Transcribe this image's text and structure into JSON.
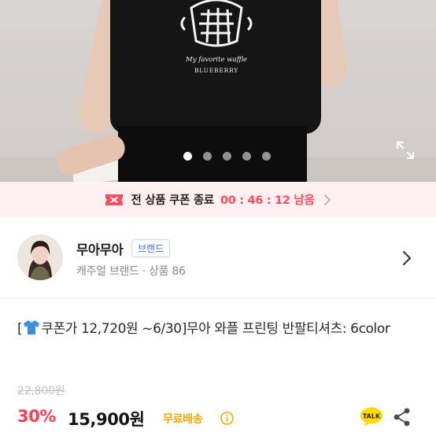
{
  "hero": {
    "print_line1": "My favorite waffle",
    "print_line2": "BLUEBERRY",
    "page_dots": 5,
    "active_dot": 1,
    "expand_icon": "expand-icon"
  },
  "coupon_strip": {
    "icon": "coupon-ticket-icon",
    "label": "전 상품 쿠폰 종료",
    "timer": "00 : 46 : 12 남음",
    "accent_color": "#ff4b5e",
    "background": "#fff0f2"
  },
  "shop": {
    "name": "무아무아",
    "badge": "브랜드",
    "meta": "캐주얼 브랜드 · 상품 86"
  },
  "product": {
    "title_prefix": "[",
    "title_icon": "t-shirt-emoji-icon",
    "title_rest": "쿠폰가 12,720원 ~6/30]무아 와플 프린팅 반팔티셔츠: 6color",
    "original_price": "22,800원",
    "discount": "30%",
    "price": "15,900원",
    "shipping": "무료배송",
    "talk_label": "TALK"
  },
  "colors": {
    "discount": "#ff3b52",
    "shipping": "#f2a900",
    "brand_badge": "#3d6bff"
  }
}
